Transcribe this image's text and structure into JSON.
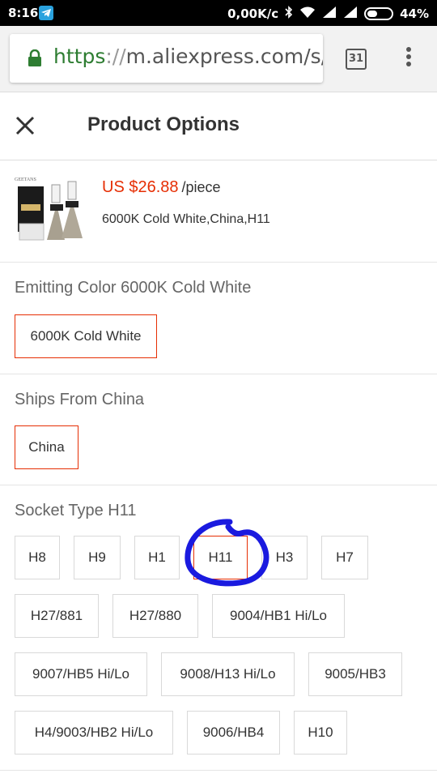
{
  "status_bar": {
    "time": "8:16",
    "net_speed": "0,00K/c",
    "battery": "44%",
    "battery_level": 0.44
  },
  "browser": {
    "url_scheme": "https",
    "url_sep": "://",
    "url_rest": "m.aliexpress.com/s/ite",
    "tab_count": "31"
  },
  "header": {
    "title": "Product Options"
  },
  "product": {
    "price": "US $26.88",
    "price_unit": "/piece",
    "summary": "6000K Cold White,China,H11",
    "thumb_brand": "GEETANS"
  },
  "sections": {
    "color": {
      "label": "Emitting Color 6000K Cold White",
      "options": [
        "6000K Cold White"
      ],
      "selected": "6000K Cold White"
    },
    "ships": {
      "label": "Ships From China",
      "options": [
        "China"
      ],
      "selected": "China"
    },
    "socket": {
      "label": "Socket Type H11",
      "options": [
        "H8",
        "H9",
        "H1",
        "H11",
        "H3",
        "H7",
        "H27/881",
        "H27/880",
        "9004/HB1 Hi/Lo",
        "9007/HB5 Hi/Lo",
        "9008/H13 Hi/Lo",
        "9005/HB3",
        "H4/9003/HB2 Hi/Lo",
        "9006/HB4",
        "H10"
      ],
      "selected": "H11"
    }
  },
  "colors": {
    "accent": "#e62e04",
    "annotation": "#1a1adf",
    "secure": "#2e7d32"
  }
}
